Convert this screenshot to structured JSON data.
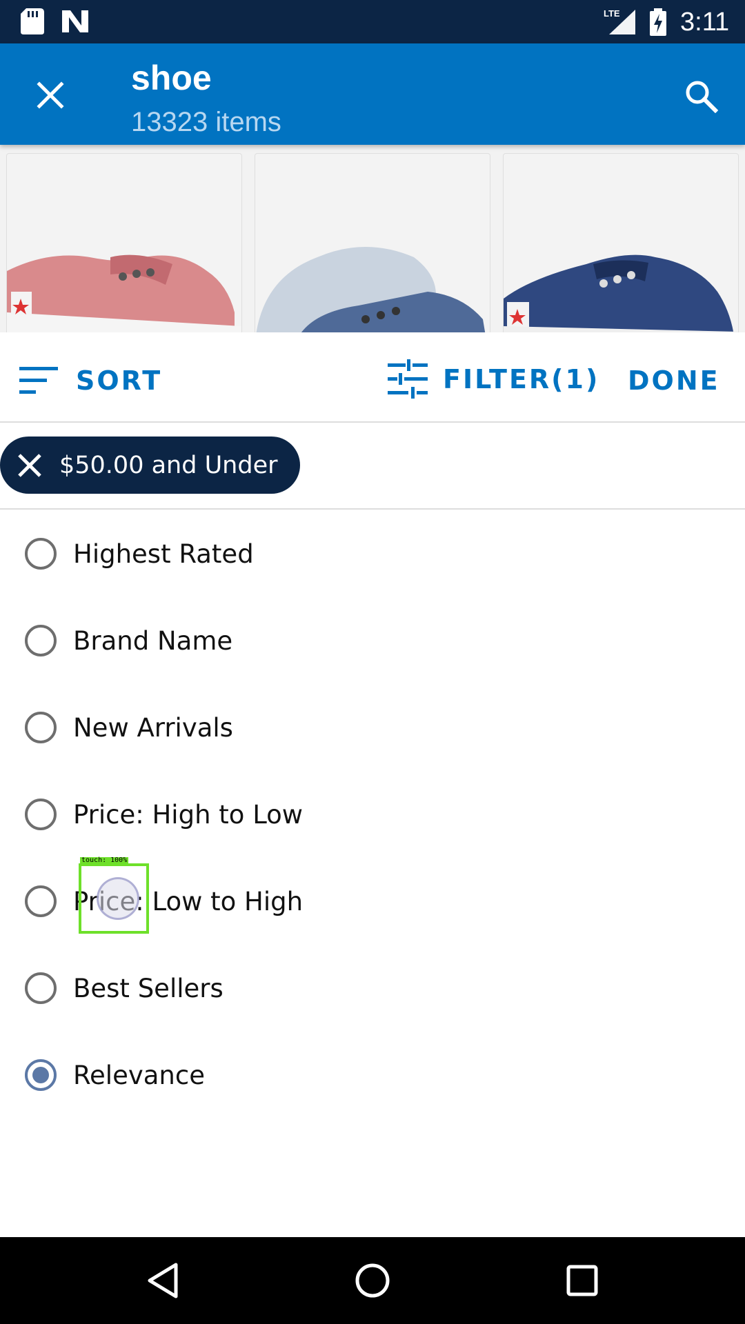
{
  "status_bar": {
    "time": "3:11",
    "network": "LTE",
    "icons": [
      "sd-card-icon",
      "n-notification-icon",
      "lte-signal-icon",
      "battery-charging-icon"
    ]
  },
  "app_bar": {
    "title": "shoe",
    "subtitle": "13323 items",
    "close_icon": "close-icon",
    "search_icon": "search-icon"
  },
  "products": [
    {
      "name": "pink-canvas-shoe",
      "color": "#d98a8c"
    },
    {
      "name": "light-blue-canvas-shoe",
      "color": "#4f6a98"
    },
    {
      "name": "navy-canvas-shoe",
      "color": "#2f4880"
    }
  ],
  "toolbar": {
    "sort_label": "SORT",
    "filter_label": "FILTER(1)",
    "done_label": "DONE"
  },
  "active_filter": {
    "label": "$50.00 and Under"
  },
  "sort_options": [
    {
      "label": "Highest Rated",
      "selected": false
    },
    {
      "label": "Brand Name",
      "selected": false
    },
    {
      "label": "New Arrivals",
      "selected": false
    },
    {
      "label": "Price: High to Low",
      "selected": false
    },
    {
      "label": "Price: Low to High",
      "selected": false
    },
    {
      "label": "Best Sellers",
      "selected": false
    },
    {
      "label": "Relevance",
      "selected": true
    }
  ],
  "touch_overlay": {
    "label": "touch: 100%"
  },
  "colors": {
    "status_bar": "#0c2545",
    "app_bar": "#0173c1",
    "accent": "#0173c1",
    "chip": "#0c2545",
    "radio_checked": "#5b78a6"
  }
}
